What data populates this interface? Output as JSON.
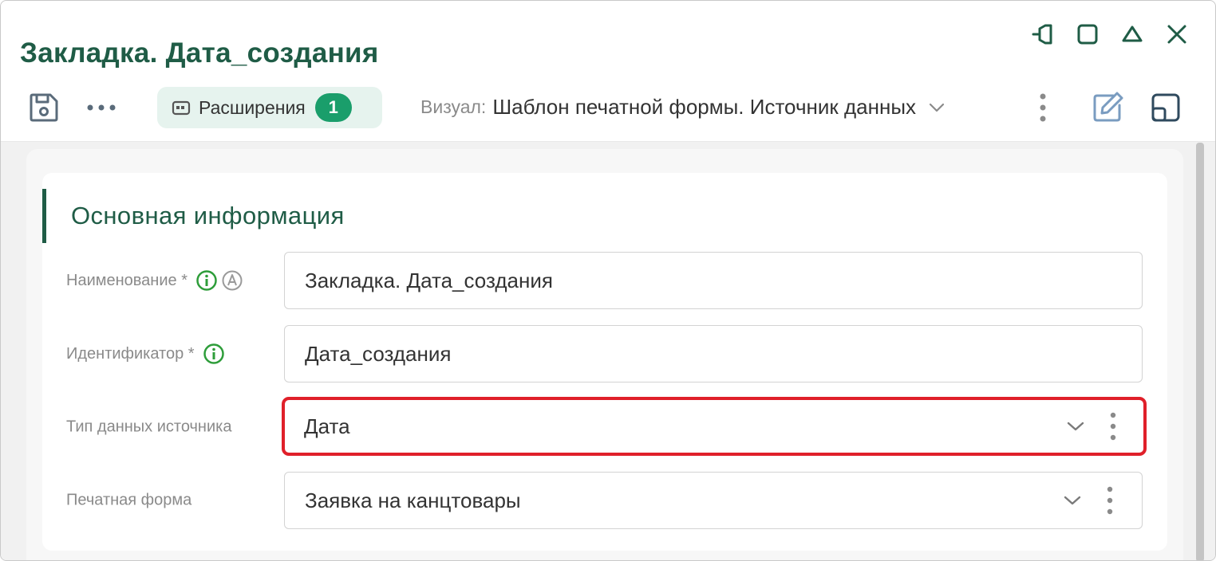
{
  "window": {
    "title": "Закладка. Дата_создания",
    "controls": [
      "pin-icon",
      "maximize-icon",
      "collapse-icon",
      "close-icon"
    ]
  },
  "toolbar": {
    "save_icon": "save-icon",
    "more_icon": "more-horizontal-icon",
    "extensions": {
      "label": "Расширения",
      "count": "1"
    },
    "visual": {
      "label": "Визуал:",
      "value": "Шаблон печатной формы. Источник данных"
    },
    "edit_icon": "edit-icon",
    "layout_icon": "layout-icon"
  },
  "section": {
    "title": "Основная информация"
  },
  "fields": {
    "name": {
      "label": "Наименование *",
      "value": "Закладка. Дата_создания"
    },
    "identifier": {
      "label": "Идентификатор *",
      "value": "Дата_создания"
    },
    "source_type": {
      "label": "Тип данных источника",
      "value": "Дата"
    },
    "print_form": {
      "label": "Печатная форма",
      "value": "Заявка на канцтовары"
    }
  },
  "colors": {
    "brand": "#1f5c46",
    "badge": "#1a9e6b",
    "pill_bg": "#e6f3ee",
    "highlight": "#e0202a",
    "info_green": "#2e9d3a"
  }
}
